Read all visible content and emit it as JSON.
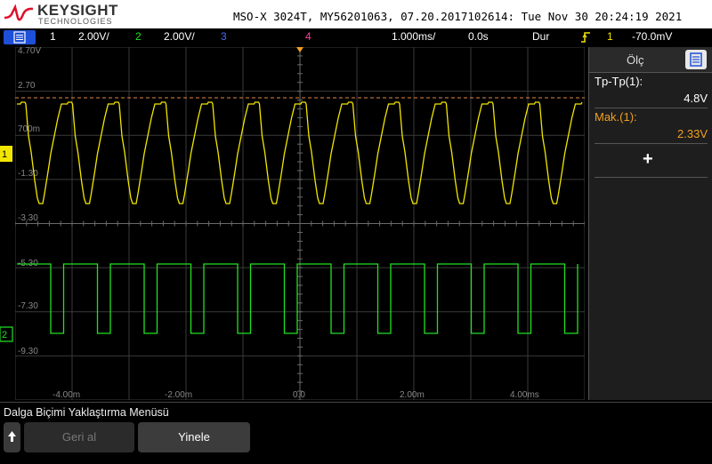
{
  "header": {
    "brand": "KEYSIGHT",
    "sub": "TECHNOLOGIES",
    "title": "MSO-X 3024T, MY56201063, 07.20.2017102614: Tue Nov 30 20:24:19 2021"
  },
  "status": {
    "ch1_num": "1",
    "ch1_scale": "2.00V/",
    "ch2_num": "2",
    "ch2_scale": "2.00V/",
    "ch3_num": "3",
    "ch4_num": "4",
    "timebase": "1.000ms/",
    "delay": "0.0s",
    "trigger_mode": "Dur",
    "trigger_source": "1",
    "trigger_level": "-70.0mV"
  },
  "scope": {
    "volt_labels": [
      "4.70V",
      "2.70",
      "700m",
      "-1.30",
      "-3.30",
      "-5.30",
      "-7.30",
      "-9.30"
    ],
    "time_labels": [
      "-4.00m",
      "-2.00m",
      "0.0",
      "2.00m",
      "4.00ms"
    ],
    "ch1_color": "#f2e600",
    "ch2_color": "#22e022",
    "ch3_color": "#4a6cff",
    "ch4_color": "#ff3fa0",
    "ch1_marker": "1",
    "ch2_marker": "2"
  },
  "panel": {
    "tab_label": "Ölç",
    "meas": [
      {
        "label": "Tp-Tp(1):",
        "value": "4.8V"
      },
      {
        "label": "Mak.(1):",
        "value": "2.33V"
      }
    ],
    "add_symbol": "+"
  },
  "menu": {
    "title": "Dalga Biçimi Yaklaştırma Menüsü",
    "softkeys": [
      "Geri al",
      "Yinele"
    ]
  }
}
